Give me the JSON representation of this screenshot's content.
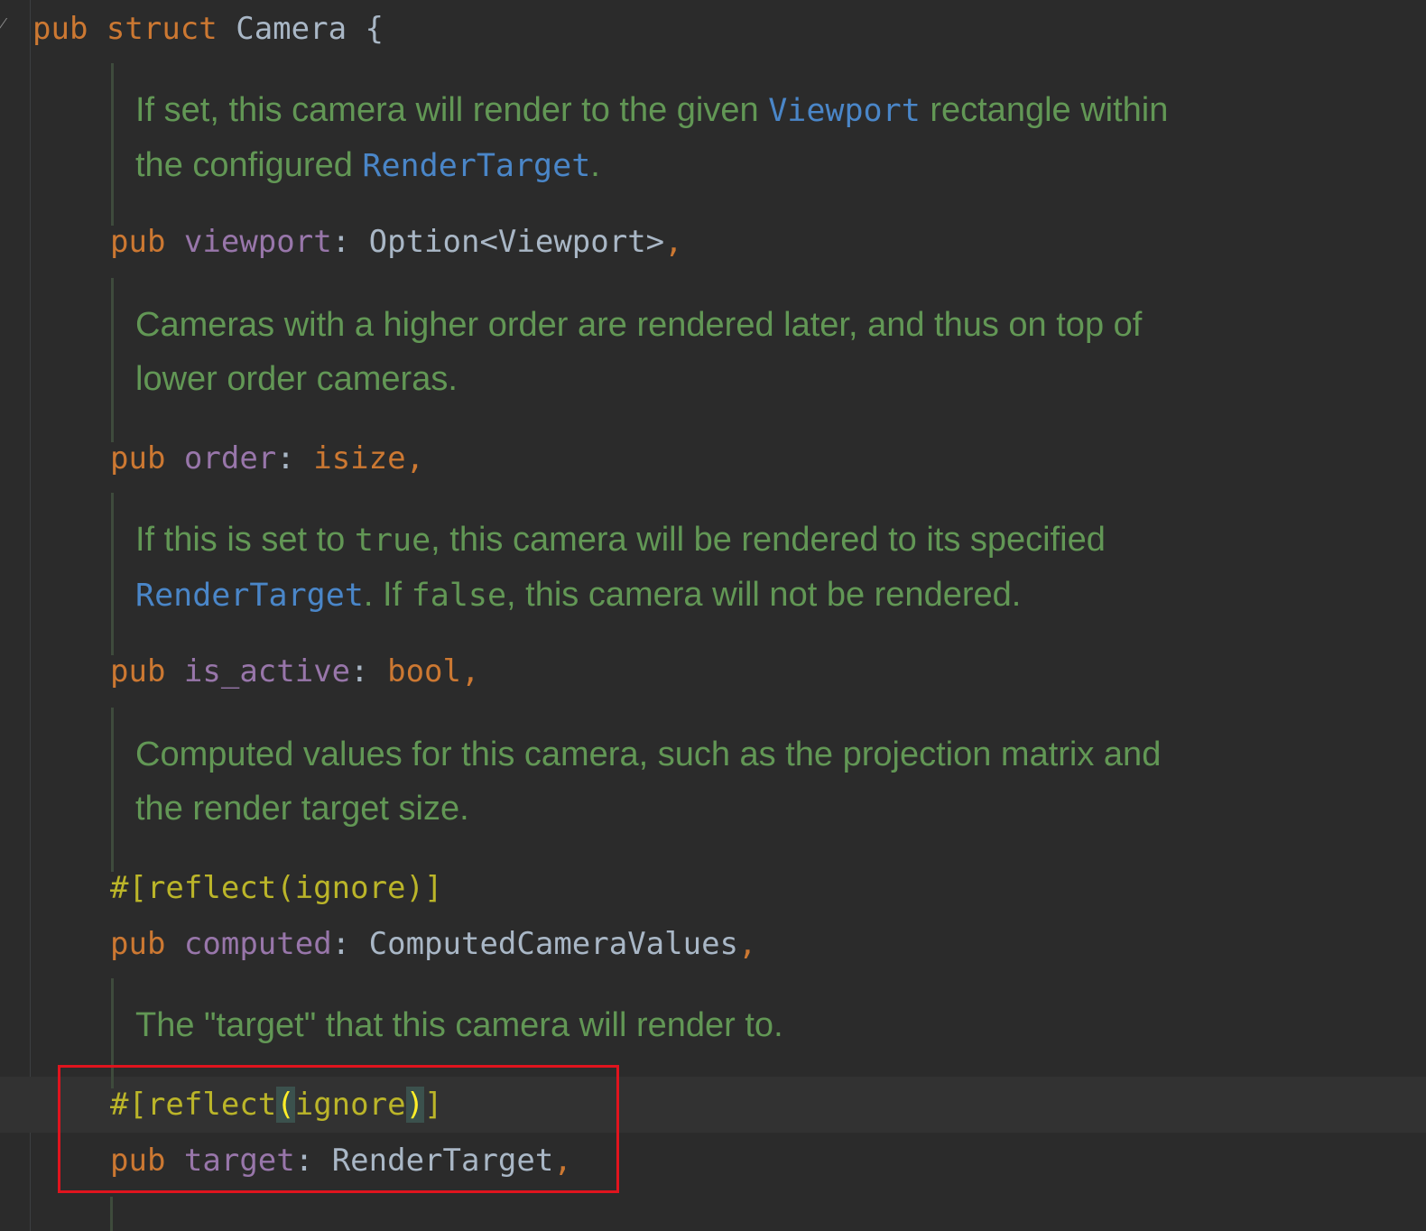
{
  "struct_line": {
    "pub": "pub",
    "struct": "struct",
    "name": "Camera",
    "brace": "{"
  },
  "docs": {
    "viewport": {
      "l1_a": "If set, this camera will render to the given ",
      "l1_link": "Viewport",
      "l1_b": " rectangle within",
      "l2_a": "the configured ",
      "l2_link": "RenderTarget",
      "l2_b": "."
    },
    "order": {
      "l1": "Cameras with a higher order are rendered later, and thus on top of",
      "l2": "lower order cameras."
    },
    "is_active": {
      "l1_a": "If this is set to ",
      "l1_code": "true",
      "l1_b": ", this camera will be rendered to its specified",
      "l2_link": "RenderTarget",
      "l2_a": ". If ",
      "l2_code": "false",
      "l2_b": ", this camera will not be rendered."
    },
    "computed": {
      "l1": "Computed values for this camera, such as the projection matrix and",
      "l2": "the render target size."
    },
    "target": {
      "l1": "The \"target\" that this camera will render to."
    }
  },
  "fields": {
    "viewport": {
      "pub": "pub",
      "name": "viewport",
      "colon": ": ",
      "type": "Option<Viewport>",
      "comma": ","
    },
    "order": {
      "pub": "pub",
      "name": "order",
      "colon": ": ",
      "type": "isize",
      "comma": ","
    },
    "is_active": {
      "pub": "pub",
      "name": "is_active",
      "colon": ": ",
      "type": "bool",
      "comma": ","
    },
    "computed": {
      "pub": "pub",
      "name": "computed",
      "colon": ": ",
      "type": "ComputedCameraValues",
      "comma": ","
    },
    "target": {
      "pub": "pub",
      "name": "target",
      "colon": ": ",
      "type": "RenderTarget",
      "comma": ","
    }
  },
  "attributes": {
    "computed_attr": "#[reflect(ignore)]",
    "target_attr": {
      "prefix": "#[reflect",
      "open": "(",
      "inner": "ignore",
      "close": ")",
      "suffix": "]"
    }
  },
  "colors": {
    "background": "#2b2b2b",
    "keyword": "#cc7832",
    "field": "#9876aa",
    "doc": "#629755",
    "doc_link": "#4a86c8",
    "attribute": "#bbb529",
    "highlight_box": "#e0141e"
  },
  "icons": {
    "fold": "fold-arrow-icon"
  }
}
